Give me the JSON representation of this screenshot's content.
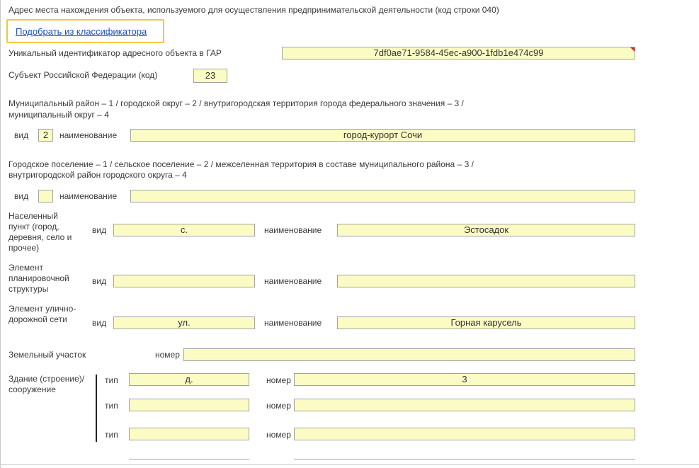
{
  "header_title": "Адрес места нахождения объекта, используемого для осуществления предпринимательской деятельности (код строки 040)",
  "classifier_link": "Подобрать из классификатора",
  "gar": {
    "label": "Уникальный идентификатор адресного объекта в ГАР",
    "value": "7df0ae71-9584-45ec-a900-1fdb1e474c99"
  },
  "subject": {
    "label": "Субъект Российской Федерации (код)",
    "value": "23"
  },
  "municipal": {
    "title_line1": "Муниципальный район – 1 / городской округ – 2 / внутригородская территория города федерального значения – 3 /",
    "title_line2": "муниципальный округ – 4",
    "vid_label": "вид",
    "vid_value": "2",
    "name_label": "наименование",
    "name_value": "город-курорт Сочи"
  },
  "settlement": {
    "title_line1": "Городское поселение – 1 / сельское поселение – 2 / межселенная территория в составе муниципального района – 3 /",
    "title_line2": "внутригородской район городского округа – 4",
    "vid_label": "вид",
    "vid_value": "",
    "name_label": "наименование",
    "name_value": ""
  },
  "locality": {
    "label": "Населенный пункт (город, деревня, село и прочее)",
    "vid_label": "вид",
    "vid_value": "с.",
    "name_label": "наименование",
    "name_value": "Эстосадок"
  },
  "planning": {
    "label": "Элемент планировочной структуры",
    "vid_label": "вид",
    "vid_value": "",
    "name_label": "наименование",
    "name_value": ""
  },
  "street": {
    "label": "Элемент улично-дорожной сети",
    "vid_label": "вид",
    "vid_value": "ул.",
    "name_label": "наименование",
    "name_value": "Горная карусель"
  },
  "land": {
    "label": "Земельный участок",
    "number_label": "номер",
    "number_value": ""
  },
  "building": {
    "label": "Здание (строение)/ сооружение",
    "rows": [
      {
        "type_label": "тип",
        "type_value": "д.",
        "number_label": "номер",
        "number_value": "3"
      },
      {
        "type_label": "тип",
        "type_value": "",
        "number_label": "номер",
        "number_value": ""
      },
      {
        "type_label": "тип",
        "type_value": "",
        "number_label": "номер",
        "number_value": ""
      }
    ]
  }
}
